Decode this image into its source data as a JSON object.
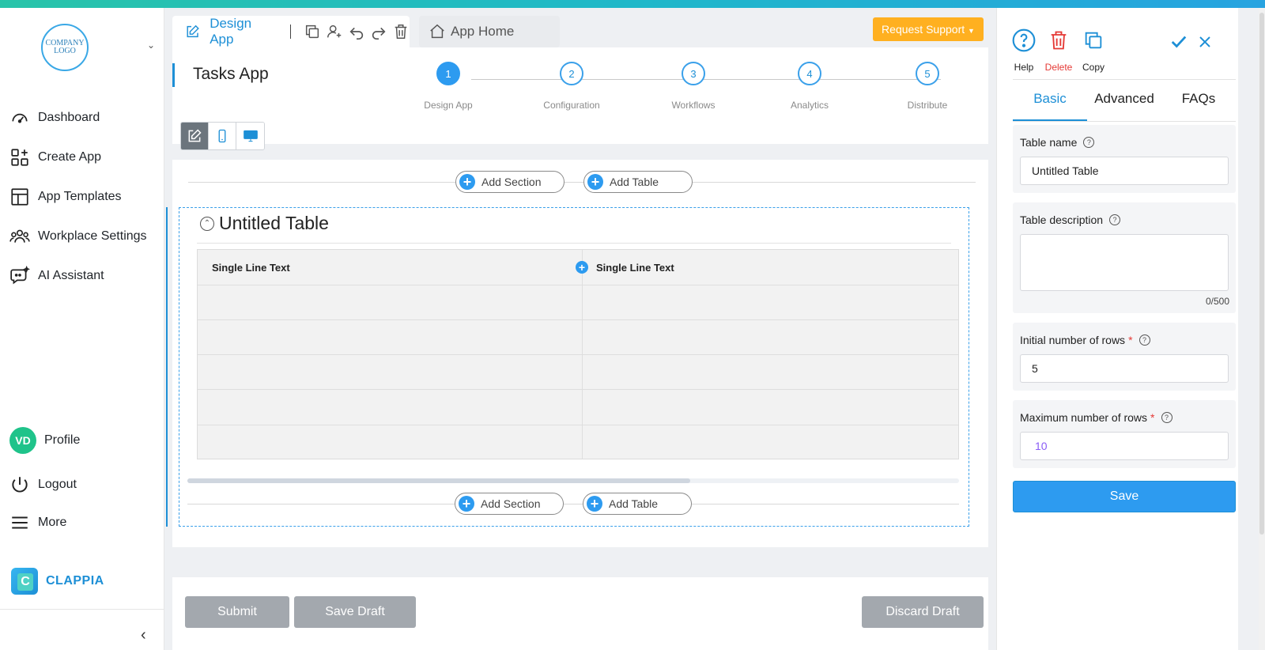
{
  "sidebar": {
    "logo_text": "COMPANY LOGO",
    "nav": [
      {
        "label": "Dashboard",
        "icon": "gauge-icon"
      },
      {
        "label": "Create App",
        "icon": "grid-plus-icon"
      },
      {
        "label": "App Templates",
        "icon": "layout-icon"
      },
      {
        "label": "Workplace Settings",
        "icon": "users-icon"
      },
      {
        "label": "AI Assistant",
        "icon": "chat-bot-icon"
      }
    ],
    "profile": {
      "initials": "VD",
      "label": "Profile",
      "avatar_color": "#1fc38a"
    },
    "logout_label": "Logout",
    "more_label": "More",
    "brand_name": "CLAPPIA",
    "brand_mark": "C"
  },
  "header": {
    "design_tab_label": "Design App",
    "app_home_label": "App Home",
    "request_support_label": "Request Support",
    "app_title": "Tasks App",
    "steps": [
      {
        "number": "1",
        "label": "Design App"
      },
      {
        "number": "2",
        "label": "Configuration"
      },
      {
        "number": "3",
        "label": "Workflows"
      },
      {
        "number": "4",
        "label": "Analytics"
      },
      {
        "number": "5",
        "label": "Distribute"
      }
    ],
    "active_step": 1
  },
  "canvas": {
    "add_section_label": "Add Section",
    "add_table_label": "Add Table",
    "section_title": "Untitled Table",
    "columns": [
      "Single Line Text",
      "Single Line Text"
    ],
    "row_count": 5
  },
  "footer": {
    "submit_label": "Submit",
    "save_draft_label": "Save Draft",
    "discard_draft_label": "Discard Draft"
  },
  "panel": {
    "actions": {
      "help": "Help",
      "delete": "Delete",
      "copy": "Copy"
    },
    "tabs": [
      "Basic",
      "Advanced",
      "FAQs"
    ],
    "active_tab": "Basic",
    "fields": {
      "table_name_label": "Table name",
      "table_name_value": "Untitled Table",
      "table_description_label": "Table description",
      "table_description_value": "",
      "description_count": "0/500",
      "initial_rows_label": "Initial number of rows",
      "initial_rows_value": "5",
      "max_rows_label": "Maximum number of rows",
      "max_rows_placeholder": "10",
      "required_mark": "*"
    },
    "save_label": "Save"
  },
  "colors": {
    "accent": "#2d9bf0",
    "warning": "#ffb020",
    "danger": "#e53935",
    "disabled_button": "#a3a8ae"
  }
}
